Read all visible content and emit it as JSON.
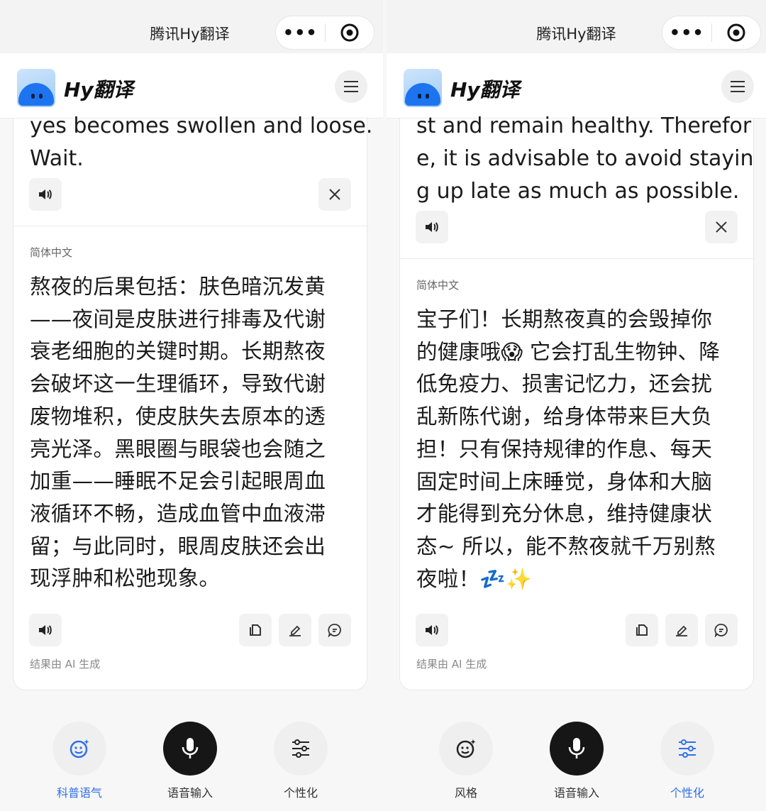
{
  "colors": {
    "accent": "#2f6fe8",
    "mic_bg": "#161616"
  },
  "panels": [
    {
      "topbar": {
        "title": "腾讯Hy翻译"
      },
      "header": {
        "brand": "Hy翻译"
      },
      "source": {
        "text": "yes becomes swollen and loose.\nWait."
      },
      "target": {
        "language": "简体中文",
        "text": "熬夜的后果包括：肤色暗沉发黄\n——夜间是皮肤进行排毒及代谢\n衰老细胞的关键时期。长期熬夜\n会破坏这一生理循环，导致代谢\n废物堆积，使皮肤失去原本的透\n亮光泽。黑眼圈与眼袋也会随之\n加重——睡眠不足会引起眼周血\n液循环不畅，造成血管中血液滞\n留；与此同时，眼周皮肤还会出\n现浮肿和松弛现象。",
        "ai_note": "结果由 AI 生成"
      },
      "bottom": {
        "left_label": "科普语气",
        "mic_label": "语音输入",
        "right_label": "个性化",
        "active": "left"
      }
    },
    {
      "topbar": {
        "title": "腾讯Hy翻译"
      },
      "header": {
        "brand": "Hy翻译"
      },
      "source": {
        "text": "st and remain healthy. Therefor\ne, it is advisable to avoid stayin\ng up late as much as possible."
      },
      "target": {
        "language": "简体中文",
        "text": "宝子们！长期熬夜真的会毁掉你\n的健康哦😱 它会打乱生物钟、降\n低免疫力、损害记忆力，还会扰\n乱新陈代谢，给身体带来巨大负\n担！只有保持规律的作息、每天\n固定时间上床睡觉，身体和大脑\n才能得到充分休息，维持健康状\n态~ 所以，能不熬夜就千万别熬\n夜啦！💤✨",
        "ai_note": "结果由 AI 生成"
      },
      "bottom": {
        "left_label": "风格",
        "mic_label": "语音输入",
        "right_label": "个性化",
        "active": "right"
      }
    }
  ],
  "icons": {
    "more": "more-dots-icon",
    "target": "record-target-icon",
    "menu": "hamburger-menu-icon",
    "speaker": "speaker-icon",
    "close": "close-icon",
    "copy": "copy-icon",
    "edit": "edit-icon",
    "feedback": "feedback-icon",
    "style": "smiley-sparkle-icon",
    "mic": "microphone-icon",
    "settings": "sliders-icon"
  }
}
